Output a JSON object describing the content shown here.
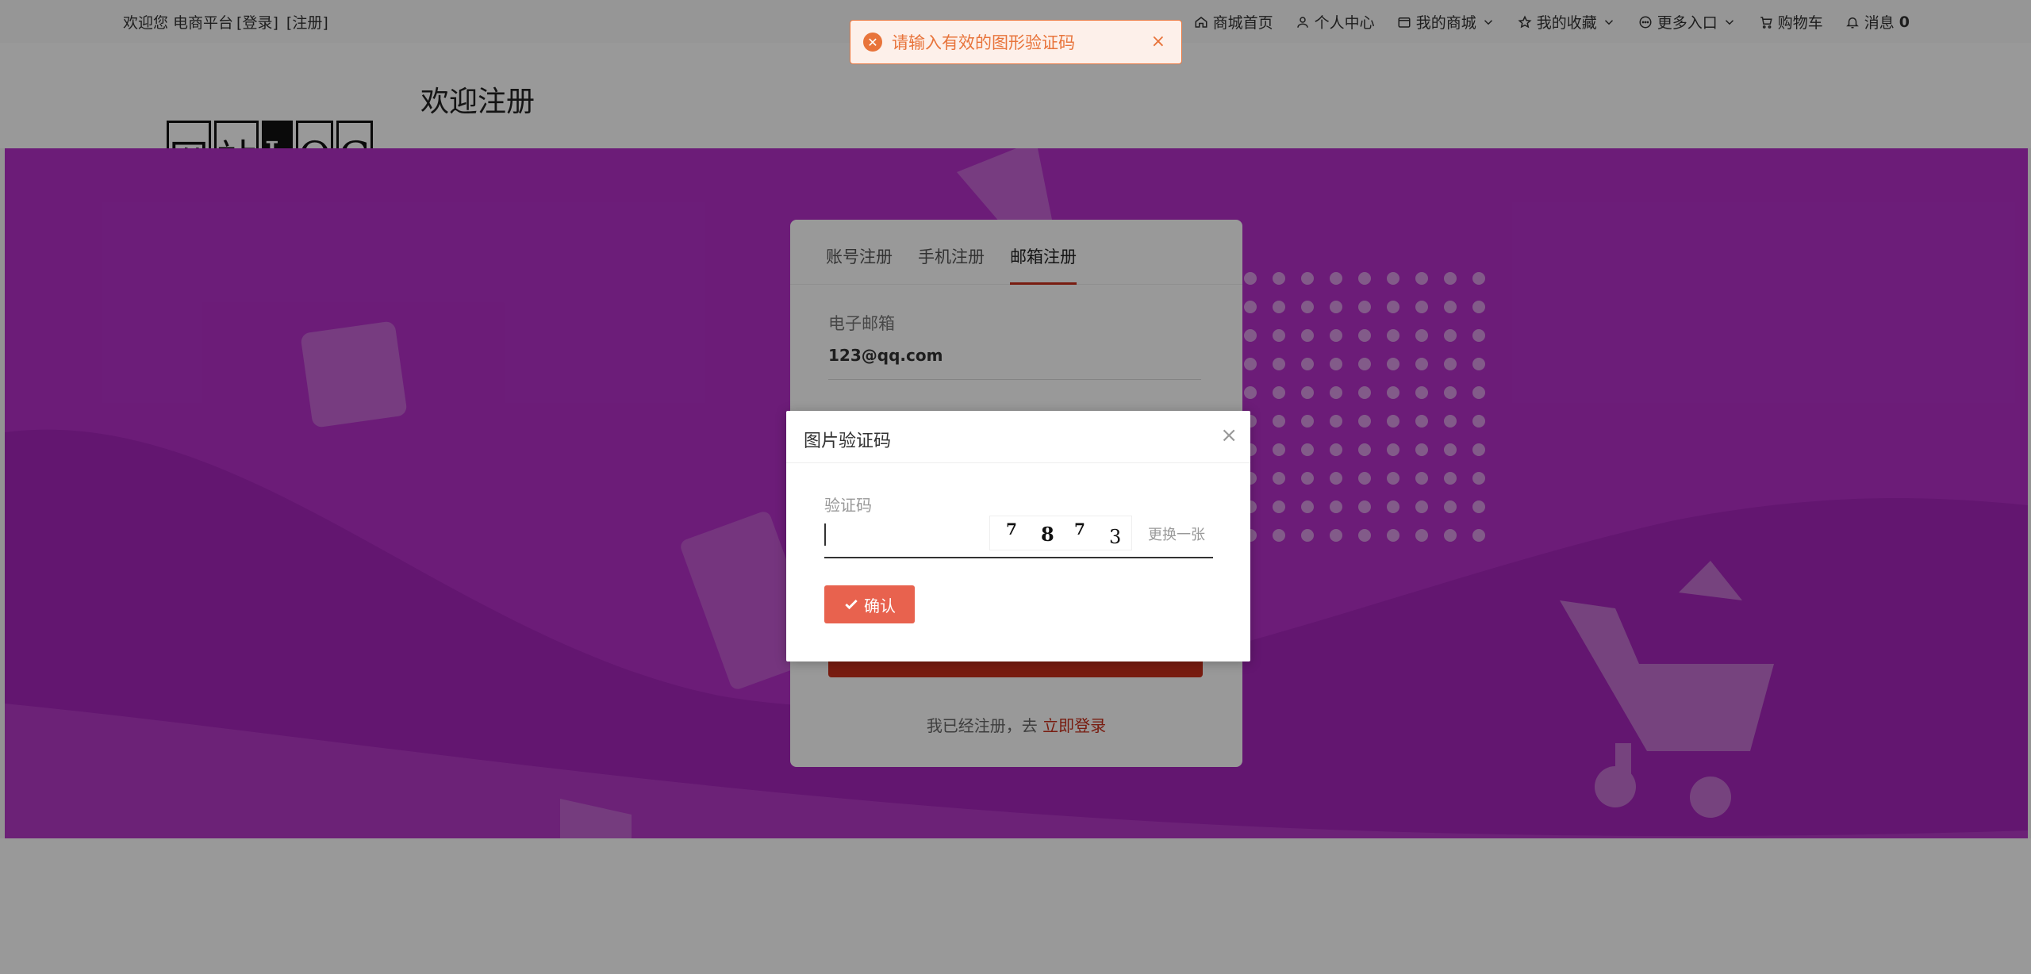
{
  "topbar": {
    "welcome": "欢迎您 电商平台",
    "login_link": "[登录]",
    "register_link": "[注册]",
    "nav": [
      {
        "label": "商城首页",
        "icon": "home-icon"
      },
      {
        "label": "个人中心",
        "icon": "user-icon"
      },
      {
        "label": "我的商城",
        "icon": "shop-icon",
        "dropdown": true
      },
      {
        "label": "我的收藏",
        "icon": "star-icon",
        "dropdown": true
      },
      {
        "label": "更多入口",
        "icon": "more-icon",
        "dropdown": true
      },
      {
        "label": "购物车",
        "icon": "cart-icon"
      },
      {
        "label": "消息",
        "icon": "bell-icon",
        "count": "0"
      }
    ]
  },
  "header": {
    "logo_chars": [
      "网",
      "站",
      "L",
      "O",
      "G"
    ],
    "title": "欢迎注册"
  },
  "register": {
    "tabs": [
      {
        "label": "账号注册",
        "active": false
      },
      {
        "label": "手机注册",
        "active": false
      },
      {
        "label": "邮箱注册",
        "active": true
      }
    ],
    "email_label": "电子邮箱",
    "email_value": "123@qq.com",
    "login_prompt": "我已经注册，去",
    "login_link": "立即登录"
  },
  "toast": {
    "message": "请输入有效的图形验证码",
    "type": "error"
  },
  "modal": {
    "title": "图片验证码",
    "code_label": "验证码",
    "code_value": "",
    "captcha_chars": [
      "7",
      "8",
      "7",
      "3"
    ],
    "change_label": "更换一张",
    "confirm_label": "确认"
  },
  "colors": {
    "banner": "#b430c9",
    "accent": "#c9301c",
    "confirm_button": "#e8624e",
    "toast": "#e8743b"
  }
}
